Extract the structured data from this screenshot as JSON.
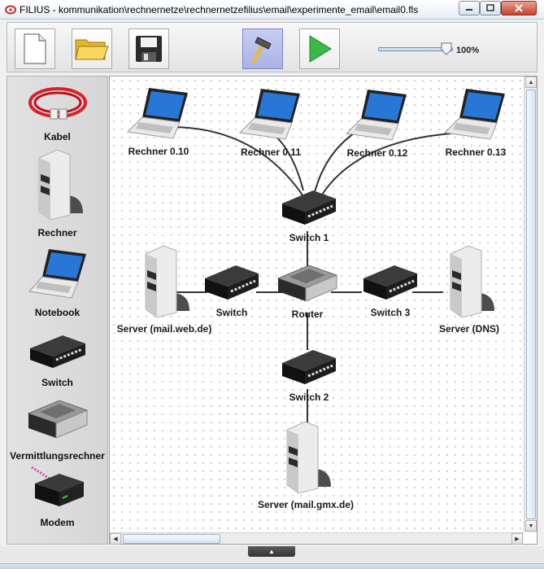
{
  "window": {
    "title": "FILIUS - kommunikation\\rechnernetze\\rechnernetzefilius\\email\\experimente_email\\email0.fls"
  },
  "toolbar": {
    "new_icon": "new-document-icon",
    "open_icon": "open-folder-icon",
    "save_icon": "save-disk-icon",
    "design_mode_icon": "hammer-icon",
    "simulation_mode_icon": "play-icon",
    "zoom_label": "100%"
  },
  "palette": {
    "items": [
      {
        "label": "Kabel",
        "icon": "cable-icon"
      },
      {
        "label": "Rechner",
        "icon": "server-icon"
      },
      {
        "label": "Notebook",
        "icon": "notebook-icon"
      },
      {
        "label": "Switch",
        "icon": "switch-icon"
      },
      {
        "label": "Vermittlungsrechner",
        "icon": "router-icon"
      },
      {
        "label": "Modem",
        "icon": "modem-icon"
      }
    ]
  },
  "network": {
    "nodes": [
      {
        "label": "Rechner 0.10",
        "type": "notebook"
      },
      {
        "label": "Rechner 0.11",
        "type": "notebook"
      },
      {
        "label": "Rechner 0.12",
        "type": "notebook"
      },
      {
        "label": "Rechner 0.13",
        "type": "notebook"
      },
      {
        "label": "Switch 1",
        "type": "switch"
      },
      {
        "label": "Server (mail.web.de)",
        "type": "server"
      },
      {
        "label": "Switch",
        "type": "switch"
      },
      {
        "label": "Router",
        "type": "router"
      },
      {
        "label": "Switch 3",
        "type": "switch"
      },
      {
        "label": "Server (DNS)",
        "type": "server"
      },
      {
        "label": "Switch 2",
        "type": "switch"
      },
      {
        "label": "Server (mail.gmx.de)",
        "type": "server"
      }
    ]
  },
  "colors": {
    "accent": "#aab2e6",
    "cable": "#333333",
    "play": "#3cb84a"
  }
}
